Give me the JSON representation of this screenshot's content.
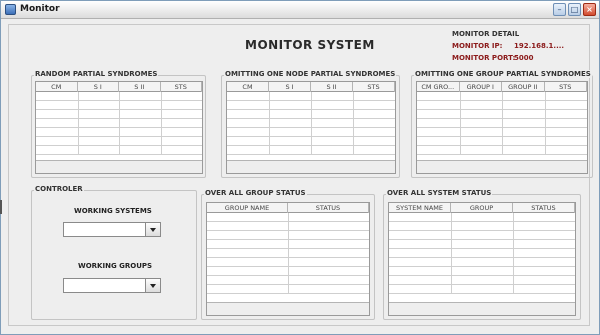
{
  "window": {
    "title": "Monitor"
  },
  "header": {
    "title": "MONITOR SYSTEM"
  },
  "monitor_detail": {
    "label": "MONITOR DETAIL",
    "ip_label": "MONITOR IP:",
    "ip_value": "192.168.1....",
    "port_label": "MONITOR PORT:",
    "port_value": "5000"
  },
  "panels": {
    "random": {
      "title": "RANDOM PARTIAL SYNDROMES",
      "columns": [
        "CM",
        "S I",
        "S II",
        "STS"
      ]
    },
    "omit_node": {
      "title": "OMITTING ONE NODE PARTIAL SYNDROMES",
      "columns": [
        "CM",
        "S I",
        "S II",
        "STS"
      ]
    },
    "omit_group": {
      "title": "OMITTING ONE GROUP PARTIAL SYNDROMES",
      "columns": [
        "CM GRO...",
        "GROUP I",
        "GROUP II",
        "STS"
      ]
    },
    "group_status": {
      "title": "OVER ALL GROUP STATUS",
      "columns": [
        "GROUP NAME",
        "STATUS"
      ]
    },
    "system_status": {
      "title": "OVER ALL SYSTEM STATUS",
      "columns": [
        "SYSTEM NAME",
        "GROUP",
        "STATUS"
      ]
    }
  },
  "controller": {
    "title": "CONTROLER",
    "working_systems_label": "WORKING SYSTEMS",
    "working_groups_label": "WORKING GROUPS",
    "working_systems_value": "",
    "working_groups_value": ""
  },
  "icons": {
    "app": "monitor-app-icon",
    "minimize": "minimize-icon",
    "maximize": "maximize-icon",
    "close": "close-icon",
    "dropdown": "chevron-down-icon"
  }
}
